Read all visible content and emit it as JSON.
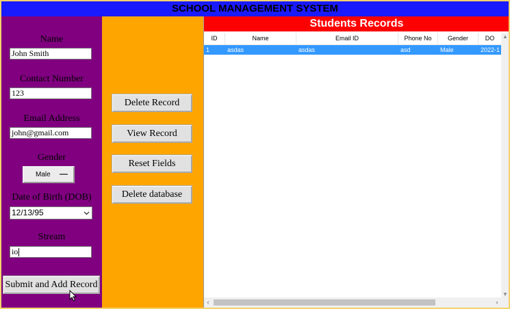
{
  "app": {
    "title": "SCHOOL MANAGEMENT SYSTEM"
  },
  "form": {
    "name_label": "Name",
    "name_value": "John Smith",
    "contact_label": "Contact Number",
    "contact_value": "123",
    "email_label": "Email Address",
    "email_value": "john@gmail.com",
    "gender_label": "Gender",
    "gender_value": "Male",
    "dob_label": "Date of Birth (DOB)",
    "dob_value": "12/13/95",
    "stream_label": "Stream",
    "stream_value": "io",
    "submit_label": "Submit and Add Record"
  },
  "actions": {
    "delete_record": "Delete Record",
    "view_record": "View Record",
    "reset_fields": "Reset Fields",
    "delete_database": "Delete database"
  },
  "records": {
    "title": "Students Records",
    "columns": [
      "ID",
      "Name",
      "Email ID",
      "Phone No",
      "Gender",
      "DO"
    ],
    "rows": [
      [
        "1",
        "asdas",
        "asdas",
        "asd",
        "Male",
        "2022-1"
      ]
    ]
  },
  "colors": {
    "title_bg": "#1a1aff",
    "left_panel": "#800080",
    "middle_panel": "#ffa500",
    "records_title_bg": "#ff0000",
    "selected_row": "#3399ff"
  }
}
